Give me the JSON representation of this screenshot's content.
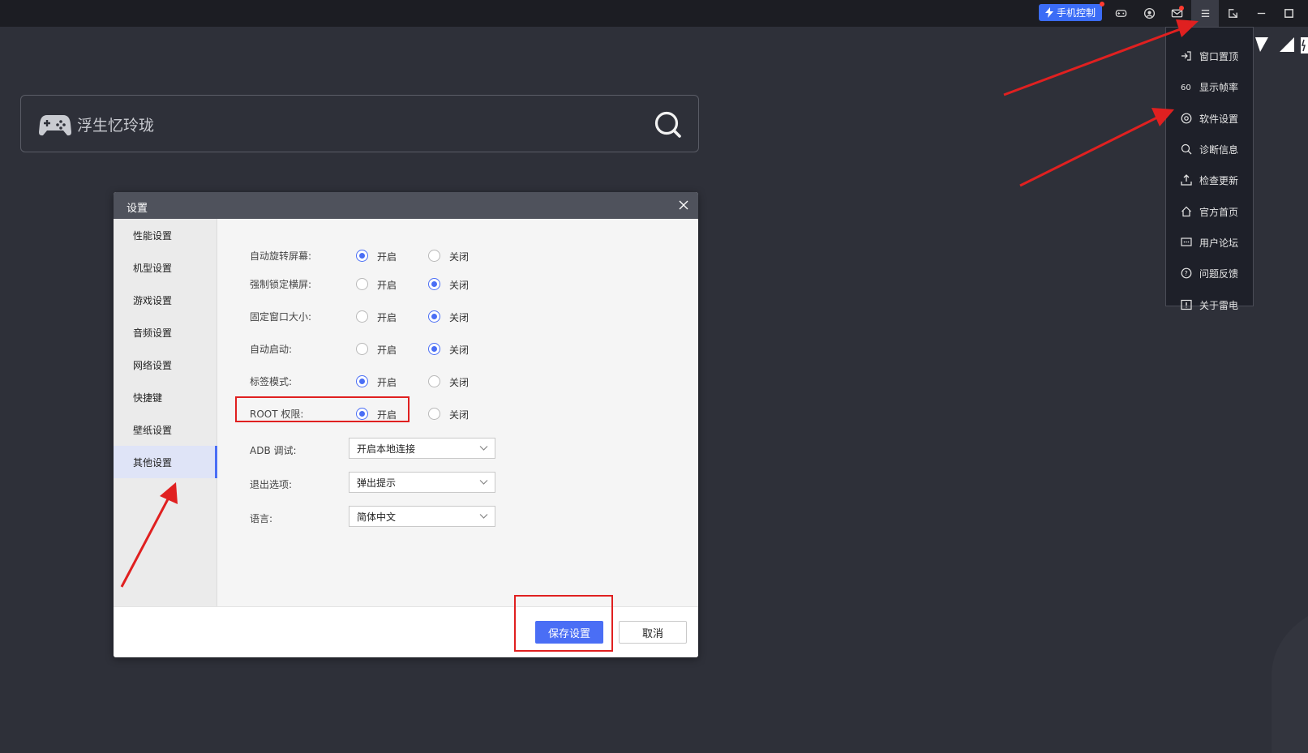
{
  "titlebar": {
    "phone_control_label": "手机控制",
    "icons": [
      "gamepad-icon",
      "user-icon",
      "mail-icon",
      "menu-icon",
      "pin-icon",
      "minimize-icon",
      "maximize-icon"
    ]
  },
  "menu": {
    "items": [
      {
        "label": "窗口置顶",
        "icon": "window-pin-icon"
      },
      {
        "label": "显示帧率",
        "icon": "fps-icon"
      },
      {
        "label": "软件设置",
        "icon": "settings-icon"
      },
      {
        "label": "诊断信息",
        "icon": "diagnose-icon"
      },
      {
        "label": "检查更新",
        "icon": "update-icon"
      },
      {
        "label": "官方首页",
        "icon": "home-icon"
      },
      {
        "label": "用户论坛",
        "icon": "forum-icon"
      },
      {
        "label": "问题反馈",
        "icon": "feedback-icon"
      },
      {
        "label": "关于雷电",
        "icon": "about-icon"
      }
    ]
  },
  "search": {
    "game_name": "浮生忆玲珑"
  },
  "dialog": {
    "title": "设置",
    "sidebar": [
      "性能设置",
      "机型设置",
      "游戏设置",
      "音频设置",
      "网络设置",
      "快捷键",
      "壁纸设置",
      "其他设置"
    ],
    "active_sidebar": "其他设置",
    "on_label": "开启",
    "off_label": "关闭",
    "options": [
      {
        "label": "自动旋转屏幕:",
        "value": "开启"
      },
      {
        "label": "强制锁定横屏:",
        "value": "关闭"
      },
      {
        "label": "固定窗口大小:",
        "value": "关闭"
      },
      {
        "label": "自动启动:",
        "value": "关闭"
      },
      {
        "label": "标签模式:",
        "value": "开启"
      },
      {
        "label": "ROOT 权限:",
        "value": "开启"
      }
    ],
    "selects": [
      {
        "label": "ADB 调试:",
        "value": "开启本地连接"
      },
      {
        "label": "退出选项:",
        "value": "弹出提示"
      },
      {
        "label": "语言:",
        "value": "简体中文"
      }
    ],
    "save_label": "保存设置",
    "cancel_label": "取消"
  },
  "colors": {
    "accent": "#4a6ef5",
    "annotation": "#e02020",
    "background": "#2e3039"
  }
}
